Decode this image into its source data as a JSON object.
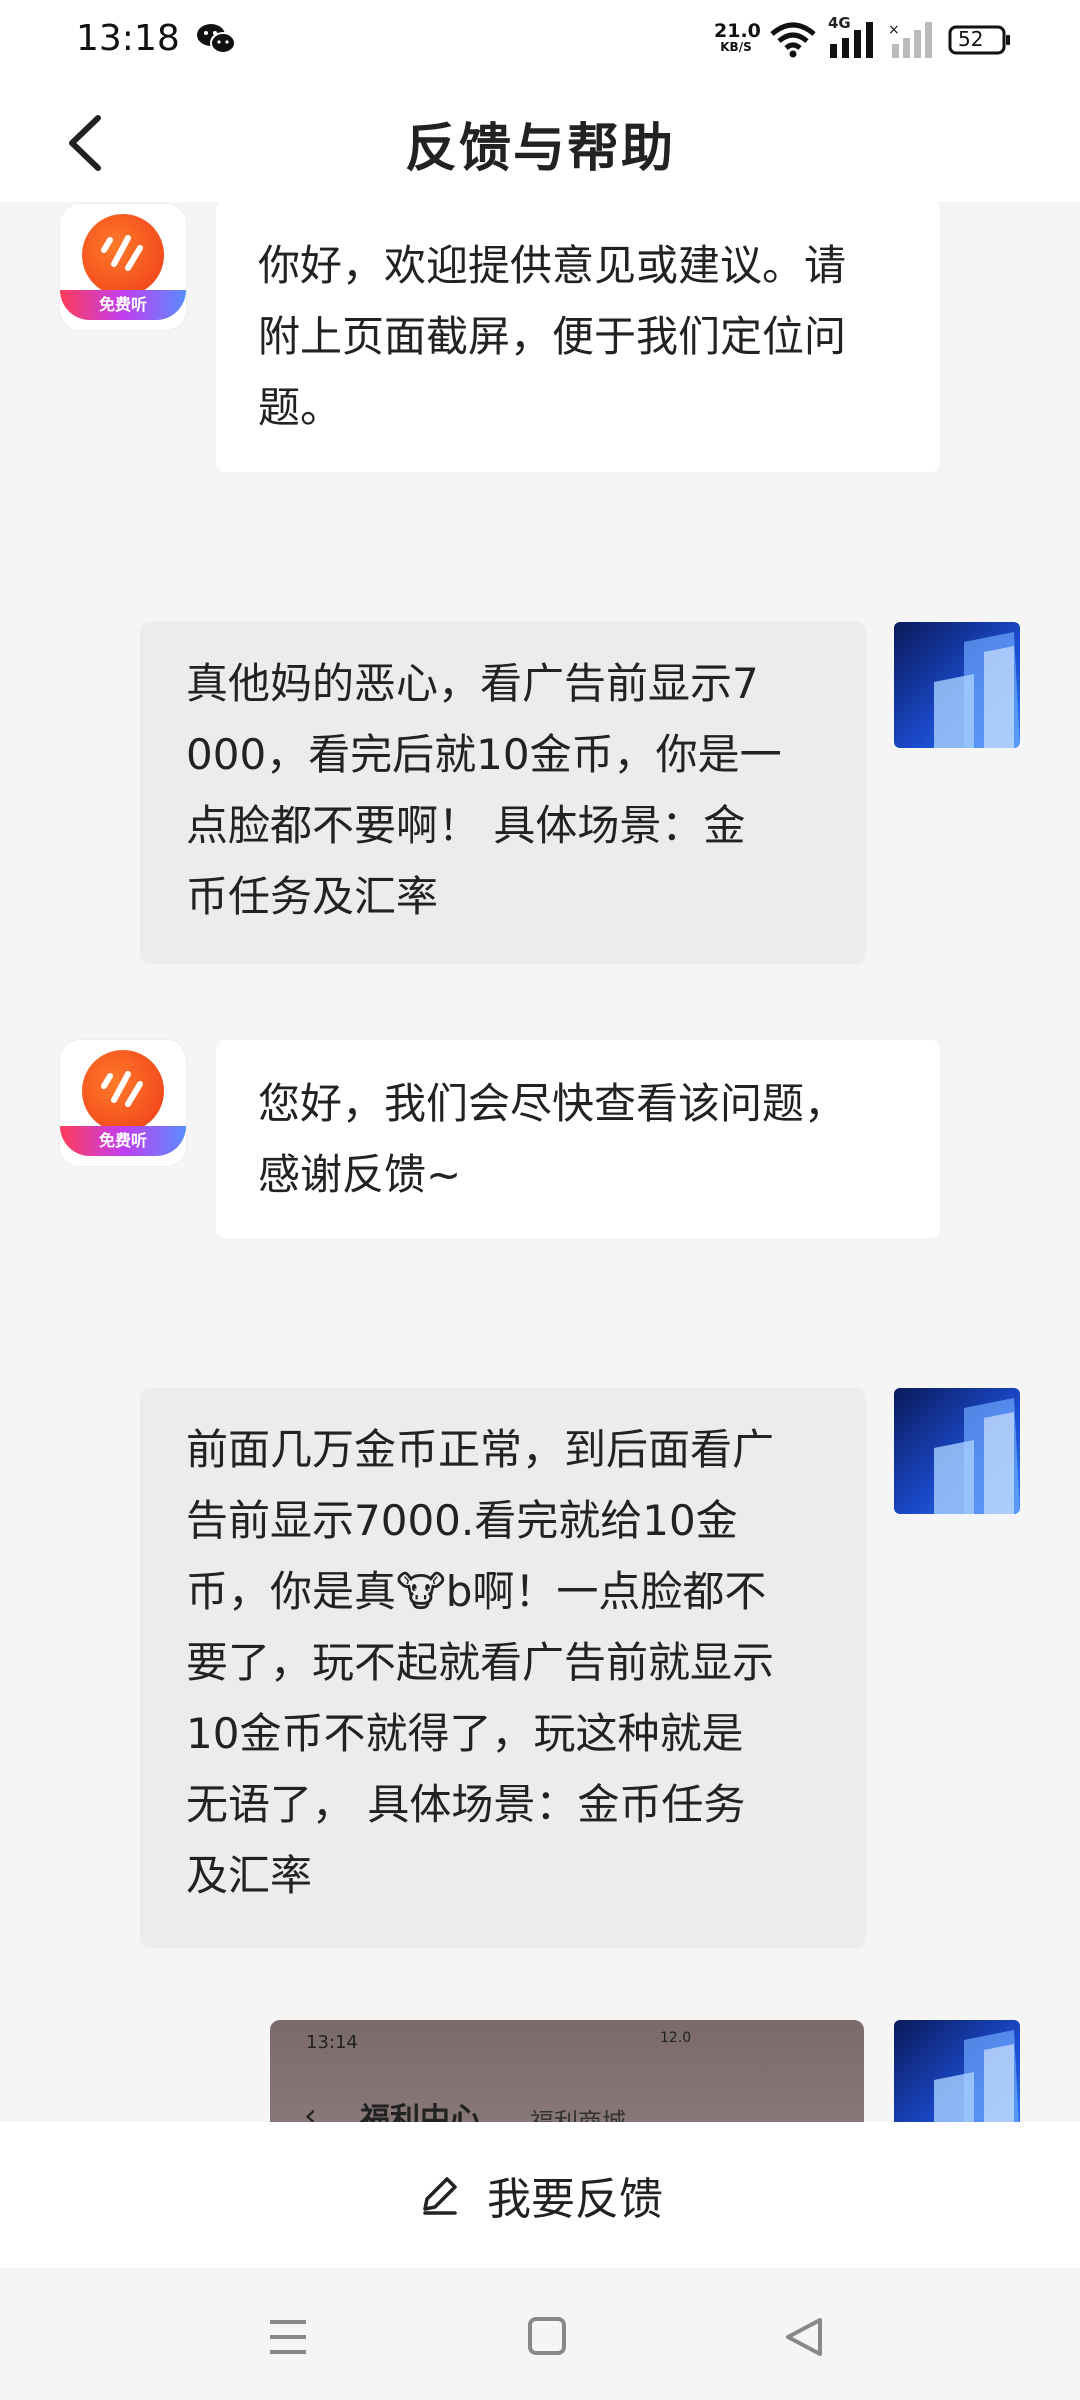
{
  "status_bar": {
    "time": "13:18",
    "net_speed": "21.0",
    "net_unit": "KB/S",
    "network_type": "4G",
    "battery": "52",
    "icons": [
      "wechat-icon",
      "wifi-icon",
      "signal-icon",
      "no-sim-signal-icon",
      "battery-icon"
    ]
  },
  "header": {
    "title": "反馈与帮助",
    "back_icon": "chevron-left-icon"
  },
  "app_avatar_badge": "免费听",
  "messages": [
    {
      "from": "app",
      "text": "你好，欢迎提供意见或建议。请\n附上页面截屏，便于我们定位问\n题。"
    },
    {
      "from": "user",
      "text": "真他妈的恶心，看广告前显示7\n000，看完后就10金币，你是一\n点脸都不要啊！ 具体场景：金\n币任务及汇率"
    },
    {
      "from": "app",
      "text": "您好，我们会尽快查看该问题，\n感谢反馈~"
    },
    {
      "from": "user",
      "text": "前面几万金币正常，到后面看广\n告前显示7000.看完就给10金\n币，你是真🐮b啊！一点脸都不\n要了，玩不起就看广告前就显示\n10金币不就得了，玩这种就是\n无语了， 具体场景：金币任务\n及汇率"
    },
    {
      "from": "user",
      "type": "image",
      "preview": {
        "time": "13:14",
        "speed": "12.0",
        "title": "福利中心",
        "subtitle": "福利商城"
      }
    }
  ],
  "feedback_button": {
    "label": "我要反馈",
    "icon": "pencil-icon"
  },
  "nav": {
    "icons": [
      "menu-icon",
      "home-square-icon",
      "back-triangle-icon"
    ]
  },
  "colors": {
    "app_orange": "#ee3a17",
    "user_bubble": "#ececec",
    "app_bubble": "#ffffff",
    "background": "#f5f5f5"
  }
}
